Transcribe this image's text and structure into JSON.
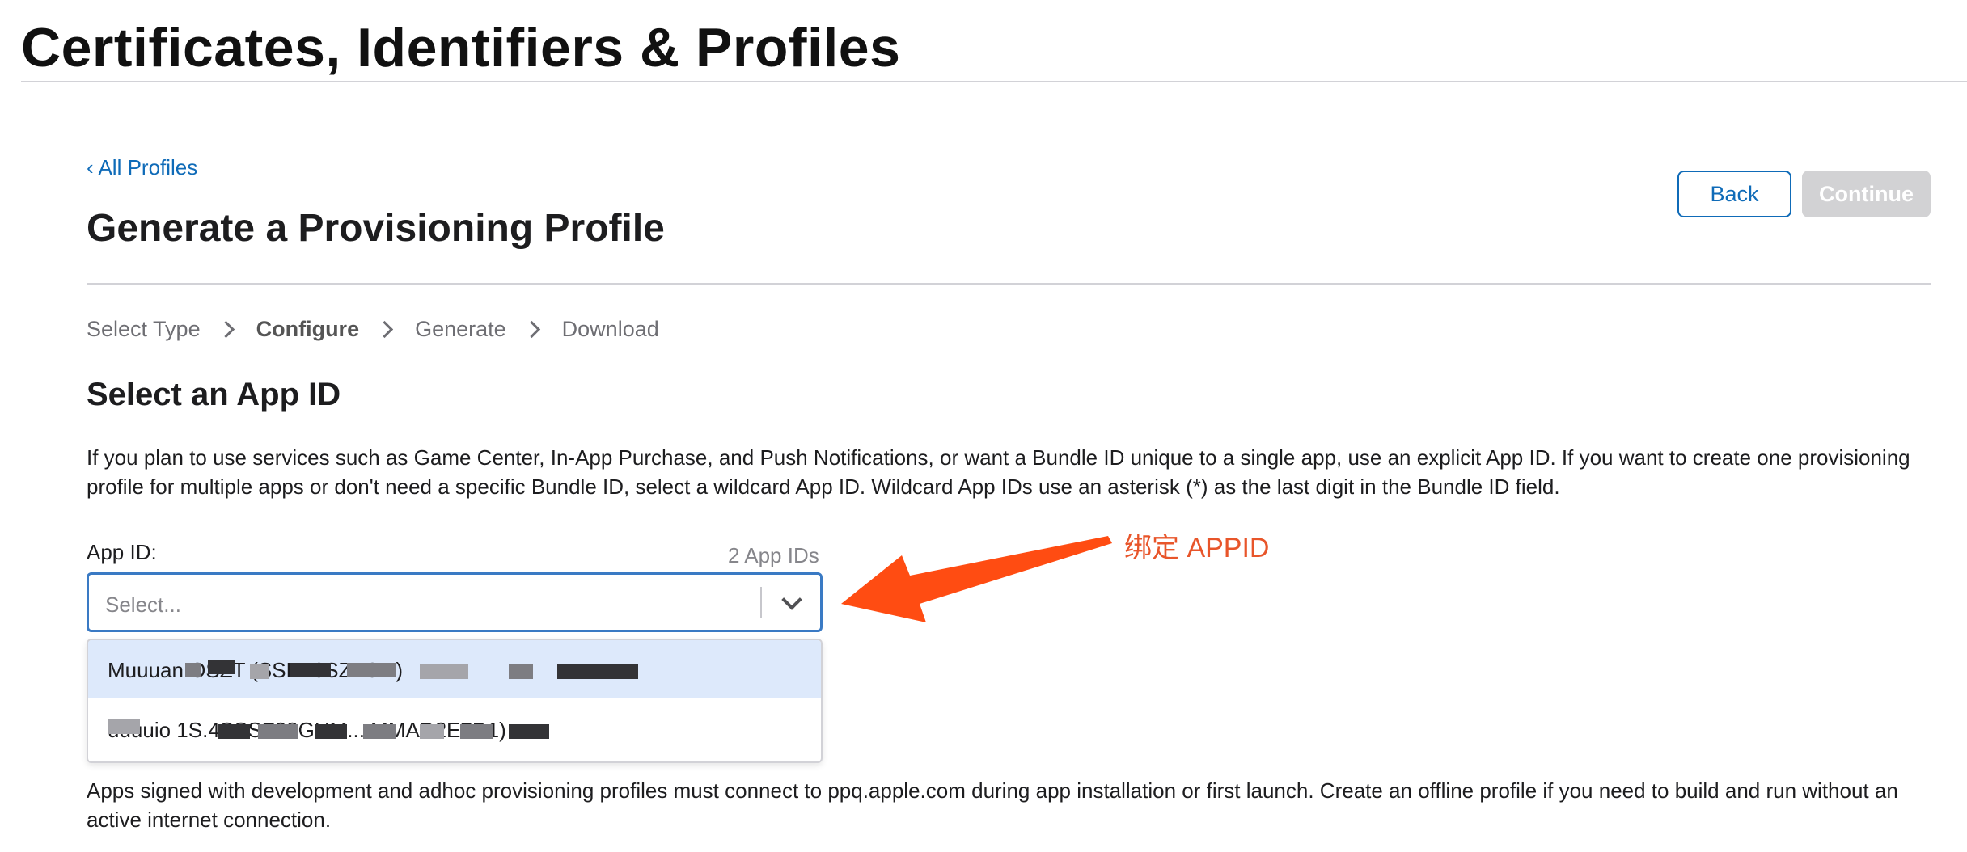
{
  "header": {
    "title": "Certificates, Identifiers & Profiles"
  },
  "nav": {
    "back_link": "‹ All Profiles"
  },
  "page": {
    "title": "Generate a Provisioning Profile",
    "back_button": "Back",
    "continue_button": "Continue"
  },
  "steps": [
    "Select Type",
    "Configure",
    "Generate",
    "Download"
  ],
  "steps_active_index": 1,
  "section": {
    "title": "Select an App ID",
    "description": "If you plan to use services such as Game Center, In-App Purchase, and Push Notifications, or want a Bundle ID unique to a single app, use an explicit App ID. If you want to create one provisioning profile for multiple apps or don't need a specific Bundle ID, select a wildcard App ID. Wildcard App IDs use an asterisk (*) as the last digit in the Bundle ID field."
  },
  "app_id_field": {
    "label": "App ID:",
    "count": "2 App IDs",
    "placeholder": "Select..."
  },
  "dropdown": {
    "options": [
      {
        "label": "MuuuanIOSZT (SSH76SZR9...)",
        "highlighted": true
      },
      {
        "label": "uuuuio  1S.4SSSF38GHM....MMAD2E7D1)",
        "highlighted": false
      }
    ]
  },
  "footer_note": "Apps signed with development and adhoc provisioning profiles must connect to ppq.apple.com during app installation or first launch. Create an offline profile if you need to build and run without an active internet connection.",
  "annotation": {
    "text": "绑定 APPID"
  },
  "colors": {
    "link": "#0f6bb8",
    "focus_border": "#3a7ac4",
    "highlight_row": "#dde9fb",
    "disabled_button": "#d2d2d4",
    "annotation": "#e8552a"
  }
}
